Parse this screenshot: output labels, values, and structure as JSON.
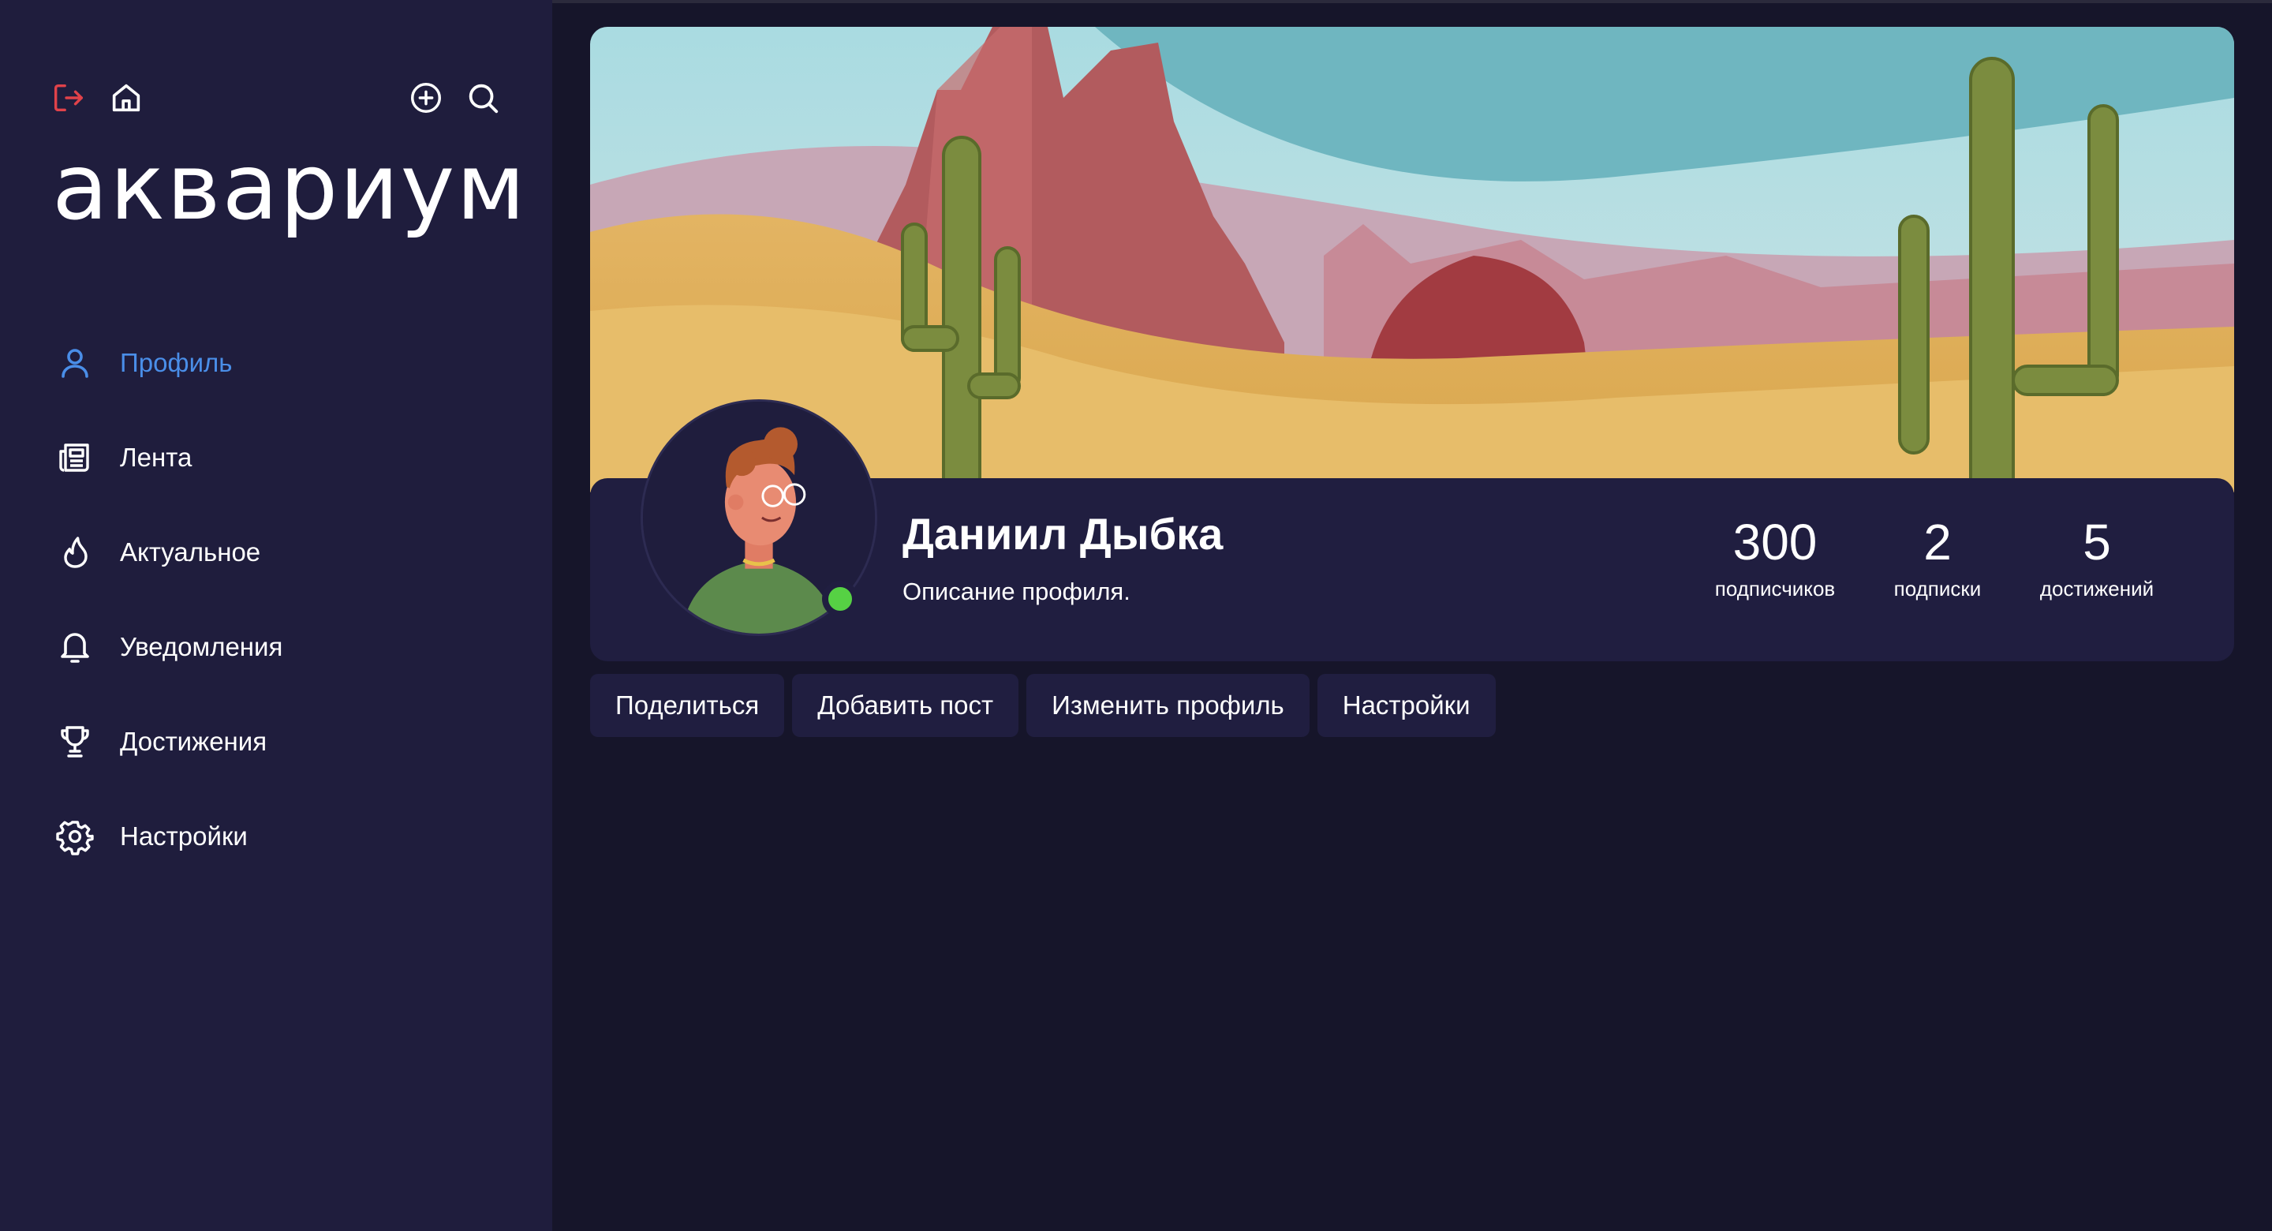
{
  "app": {
    "logo_text": "аквариум"
  },
  "header_icons": {
    "logout": "logout-icon",
    "home": "home-icon",
    "add": "plus-circle-icon",
    "search": "search-icon"
  },
  "sidebar": {
    "items": [
      {
        "label": "Профиль",
        "icon": "user-icon",
        "active": true
      },
      {
        "label": "Лента",
        "icon": "newspaper-icon",
        "active": false
      },
      {
        "label": "Актуальное",
        "icon": "flame-icon",
        "active": false
      },
      {
        "label": "Уведомления",
        "icon": "bell-icon",
        "active": false
      },
      {
        "label": "Достижения",
        "icon": "trophy-icon",
        "active": false
      },
      {
        "label": "Настройки",
        "icon": "gear-icon",
        "active": false
      }
    ]
  },
  "profile": {
    "name": "Даниил Дыбка",
    "description": "Описание профиля.",
    "online": true,
    "stats": [
      {
        "value": "300",
        "label": "подписчиков"
      },
      {
        "value": "2",
        "label": "подписки"
      },
      {
        "value": "5",
        "label": "достижений"
      }
    ]
  },
  "actions": [
    {
      "label": "Поделиться"
    },
    {
      "label": "Добавить пост"
    },
    {
      "label": "Изменить профиль"
    },
    {
      "label": "Настройки"
    }
  ],
  "colors": {
    "sidebar_bg": "#1f1d3d",
    "page_bg": "#16152a",
    "card_bg": "#201e40",
    "accent": "#4a8ee8",
    "logout_icon": "#e0424a",
    "online": "#56d144"
  }
}
